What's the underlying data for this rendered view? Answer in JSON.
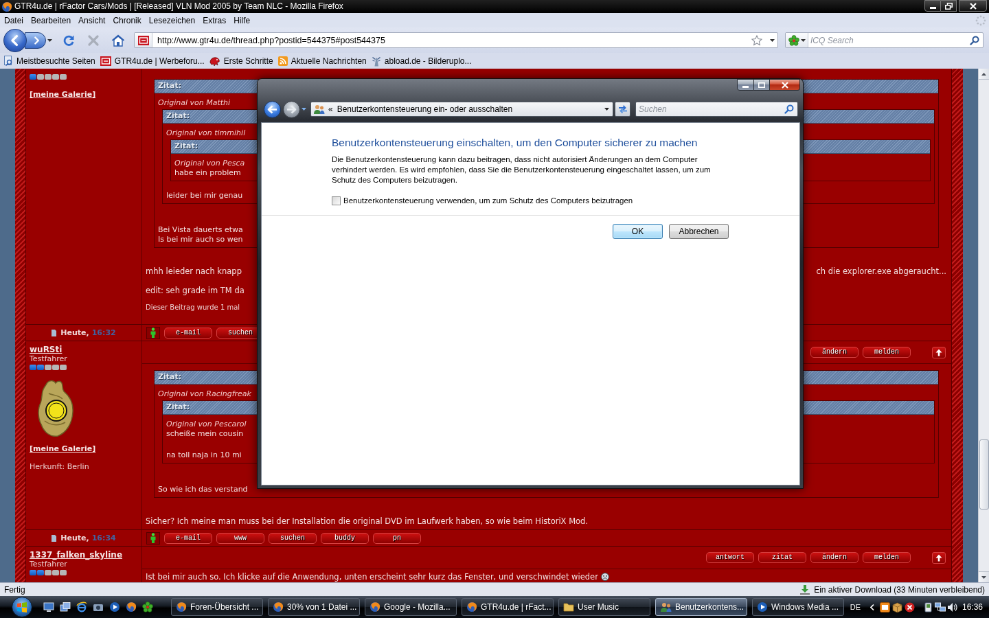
{
  "window": {
    "title": "GTR4u.de | rFactor Cars/Mods | [Released] VLN Mod 2005 by Team NLC - Mozilla Firefox"
  },
  "menu": [
    "Datei",
    "Bearbeiten",
    "Ansicht",
    "Chronik",
    "Lesezeichen",
    "Extras",
    "Hilfe"
  ],
  "toolbar": {
    "url": "http://www.gtr4u.de/thread.php?postid=544375#post544375",
    "search": {
      "placeholder": "ICQ Search"
    }
  },
  "bookmarks": [
    {
      "label": "Meistbesuchte Seiten"
    },
    {
      "label": "GTR4u.de | Werbeforu..."
    },
    {
      "label": "Erste Schritte"
    },
    {
      "label": "Aktuelle Nachrichten"
    },
    {
      "label": "abload.de - Bilderuplo..."
    }
  ],
  "posts": [
    {
      "author": {
        "stars": 1,
        "gallery": "[meine Galerie]"
      },
      "quote": {
        "header": "Zitat:",
        "source": "Original von Matthi",
        "quote": {
          "header": "Zitat:",
          "source": "Original von timmihil",
          "quote": {
            "header": "Zitat:",
            "source": "Original von Pesca",
            "paragraphs": [
              [
                "habe ein problem"
              ]
            ]
          },
          "paragraphs": [
            [
              "leider bei mir genau"
            ]
          ]
        },
        "paragraphs": [
          [
            "Bei Vista dauerts etwa",
            "Is bei mir auch so wen"
          ]
        ]
      },
      "body": [
        {
          "text": "mhh leieder nach knapp",
          "tail": "ch die explorer.exe abgeraucht..."
        },
        {
          "text": "edit: seh grade im TM da"
        }
      ],
      "edit_note": "Dieser Beitrag wurde 1 mal",
      "footer": {
        "date": "Heute,",
        "time": "16:32",
        "buttons": [
          "e-mail",
          "suchen"
        ]
      }
    },
    {
      "author": {
        "name": "wuRSti",
        "rank": "Testfahrer",
        "stars": 2,
        "avatar": true,
        "gallery": "[meine Galerie]",
        "origin": "Herkunft: Berlin"
      },
      "actions": [
        "ändern",
        "melden"
      ],
      "quote": {
        "header": "Zitat:",
        "source": "Original von Racingfreak",
        "quote": {
          "header": "Zitat:",
          "source": "Original von Pescarol",
          "paragraphs": [
            [
              "scheiße mein cousin"
            ],
            [
              "na toll naja in 10 mi"
            ]
          ]
        },
        "paragraphs": [
          [
            "So wie ich das verstand"
          ]
        ]
      },
      "body": [
        {
          "text": "Sicher? Ich meine man muss bei der Installation die original DVD im Laufwerk haben, so wie beim HistoriX Mod."
        }
      ],
      "footer": {
        "date": "Heute,",
        "time": "16:34",
        "buttons": [
          "e-mail",
          "www",
          "suchen",
          "buddy",
          "pn"
        ]
      }
    },
    {
      "author": {
        "name": "1337_falken_skyline",
        "rank": "Testfahrer",
        "stars": 2
      },
      "actions": [
        "antwort",
        "zitat",
        "ändern",
        "melden"
      ],
      "body": [
        {
          "text": "Ist bei mir auch so. Ich klicke auf die Anwendung, unten erscheint sehr kurz das Fenster, und verschwindet wieder",
          "emoticon": true
        }
      ]
    }
  ],
  "status_bar": {
    "text": "Fertig",
    "download": "Ein aktiver Download (33 Minuten verbleibend)"
  },
  "dialog": {
    "address_prefix": "«",
    "address": "Benutzerkontensteuerung ein- oder ausschalten",
    "search": {
      "placeholder": "Suchen"
    },
    "heading": "Benutzerkontensteuerung einschalten, um den Computer sicherer zu machen",
    "description": "Die Benutzerkontensteuerung kann dazu beitragen, dass nicht autorisiert Änderungen an dem Computer verhindert werden. Es wird empfohlen, dass Sie die Benutzerkontensteuerung eingeschaltet lassen, um zum Schutz des Computers beizutragen.",
    "checkbox": {
      "label": "Benutzerkontensteuerung verwenden, um zum Schutz des Computers beizutragen",
      "checked": false
    },
    "buttons": [
      {
        "label": "OK",
        "default": true
      },
      {
        "label": "Abbrechen",
        "default": false
      }
    ]
  },
  "taskbar": {
    "tasks": [
      {
        "label": "Foren-Übersicht ...",
        "kind": "browser",
        "selected": false
      },
      {
        "label": "30% von 1 Datei ...",
        "kind": "browser",
        "selected": false
      },
      {
        "label": "Google - Mozilla...",
        "kind": "browser",
        "selected": false
      },
      {
        "label": "GTR4u.de | rFact...",
        "kind": "browser",
        "selected": false
      },
      {
        "label": "User Music",
        "kind": "folder",
        "selected": false
      },
      {
        "label": "Benutzerkontens...",
        "kind": "control",
        "selected": true
      },
      {
        "label": "Windows Media ...",
        "kind": "media",
        "selected": false
      }
    ],
    "language": "DE",
    "clock": "16:36"
  }
}
